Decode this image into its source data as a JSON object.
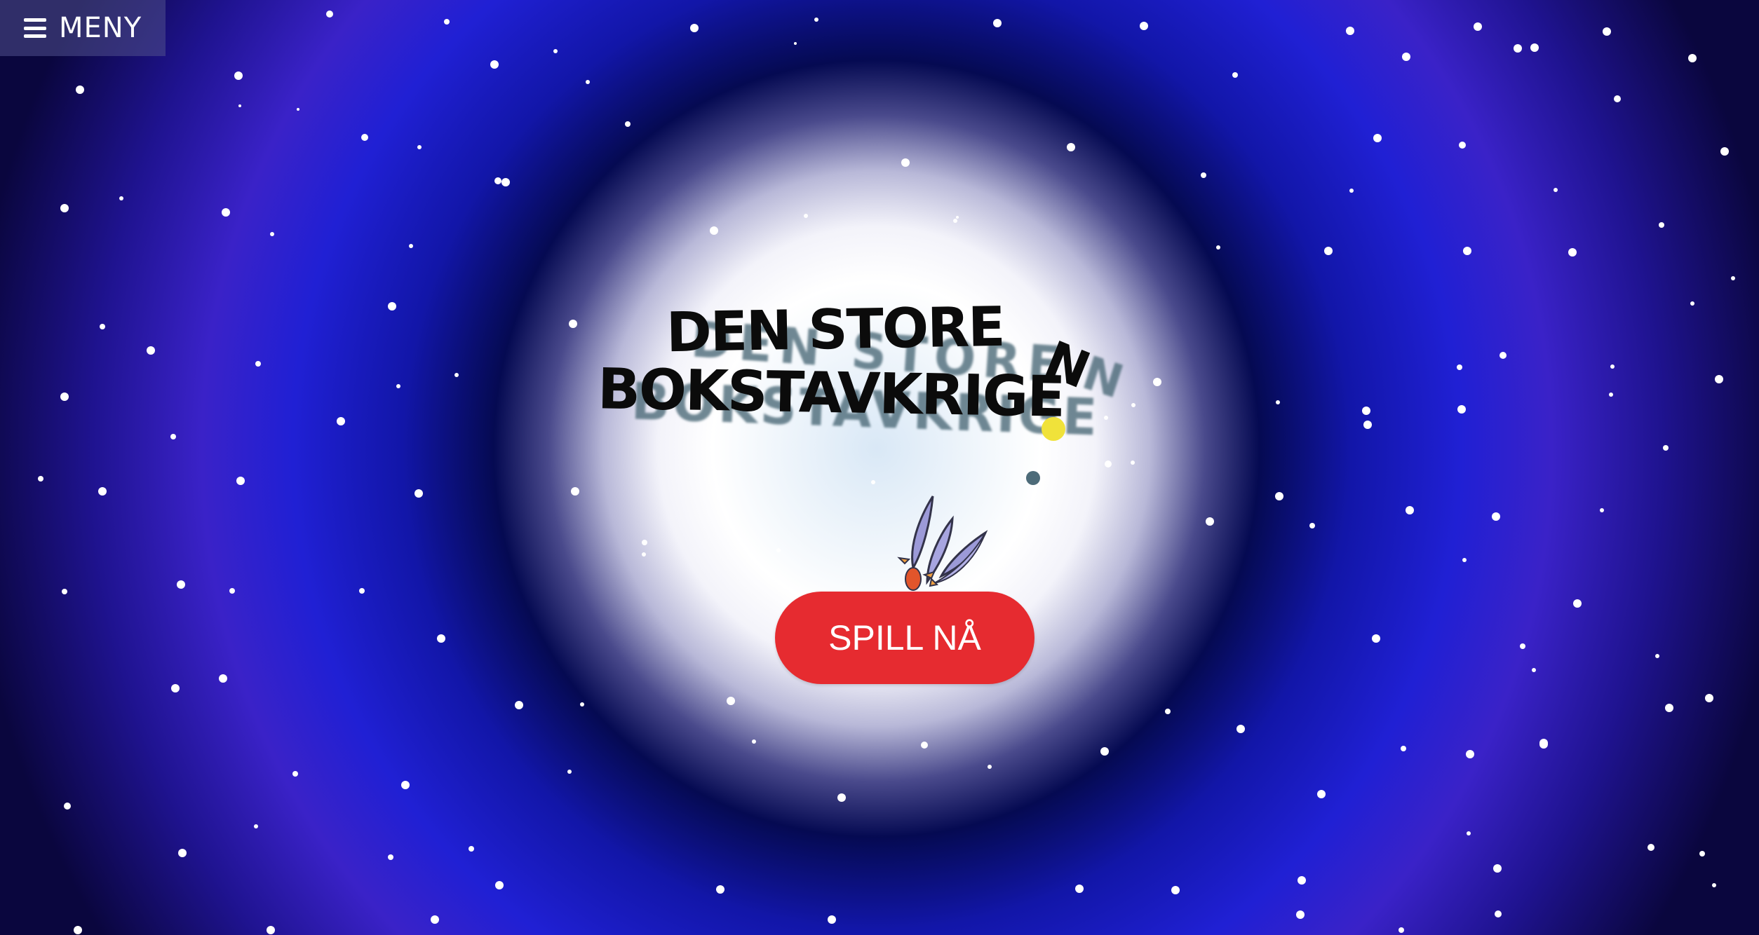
{
  "menu": {
    "label": "MENY"
  },
  "logo": {
    "line1": "DEN STORE",
    "line2": "BOKSTAVKRIGE",
    "falling_letter": "N"
  },
  "play_button": {
    "label": "SPILL NÅ"
  },
  "colors": {
    "play_button_bg": "#e62b30",
    "menu_bg": "rgba(80,80,140,0.55)",
    "space_blue": "#2020d4",
    "glow_white": "#ffffff",
    "dot_yellow": "#f0e23a",
    "dot_teal": "#4d6b79"
  },
  "icons": {
    "menu": "hamburger-icon",
    "creature": "flying-insect-creature"
  }
}
